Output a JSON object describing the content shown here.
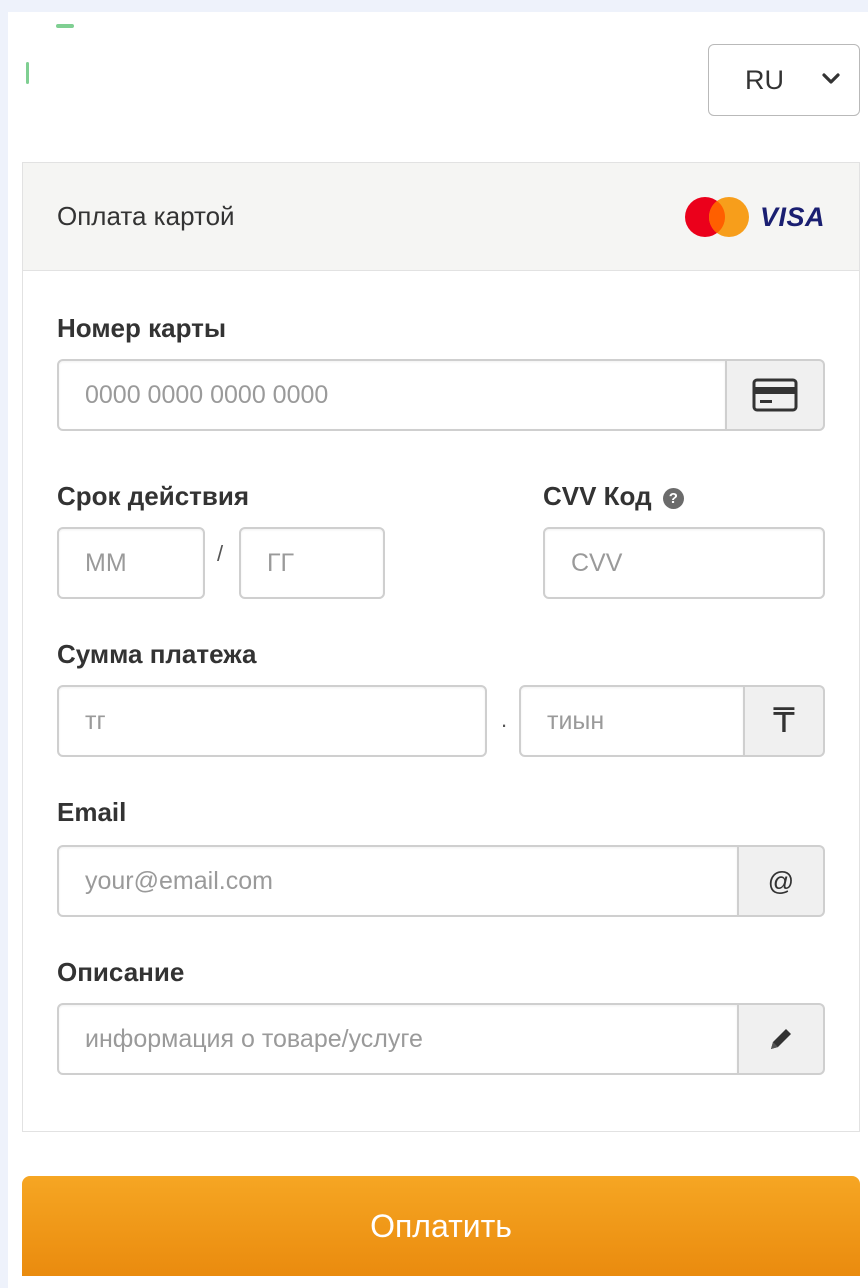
{
  "language": {
    "selected": "RU"
  },
  "card_form": {
    "title": "Оплата картой",
    "brands": {
      "visa": "VISA"
    },
    "card_number": {
      "label": "Номер карты",
      "placeholder": "0000 0000 0000 0000"
    },
    "expiry": {
      "label": "Срок действия",
      "month_placeholder": "ММ",
      "separator": "/",
      "year_placeholder": "ГГ"
    },
    "cvv": {
      "label": "CVV Код",
      "help_glyph": "?",
      "placeholder": "CVV"
    },
    "amount": {
      "label": "Сумма платежа",
      "tenge_placeholder": "тг",
      "separator": ".",
      "tiyn_placeholder": "тиын",
      "currency_symbol": "₸"
    },
    "email": {
      "label": "Email",
      "placeholder": "your@email.com",
      "addon": "@"
    },
    "description": {
      "label": "Описание",
      "placeholder": "информация о товаре/услуге"
    }
  },
  "pay_button": {
    "label": "Оплатить"
  },
  "colors": {
    "page_bg": "#eef2fb",
    "pay_button": "#f29a1b",
    "mastercard_red": "#eb001b",
    "mastercard_orange": "#f79e1b",
    "visa_blue": "#1a1f71"
  },
  "icons": [
    "chevron-down-icon",
    "mastercard-logo",
    "visa-logo",
    "credit-card-icon",
    "help-icon",
    "tenge-icon",
    "at-icon",
    "pencil-icon"
  ]
}
